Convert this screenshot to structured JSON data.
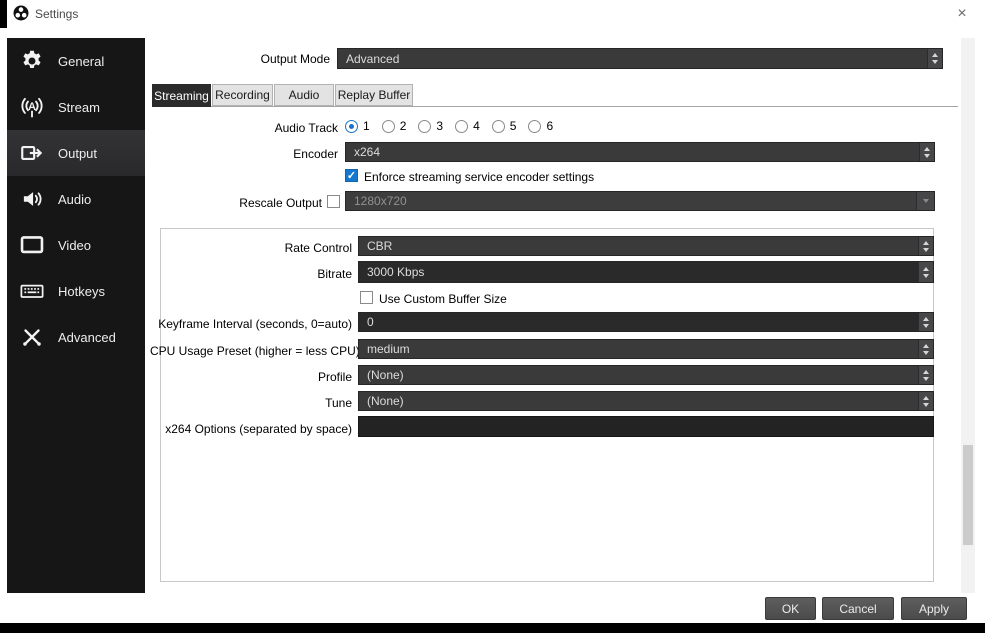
{
  "window": {
    "title": "Settings",
    "close": "×"
  },
  "colors": {
    "accent": "#1974c8",
    "sidebar_bg": "#161617",
    "control_bg": "#3a3a3b",
    "selected_tab_bg": "#2b2b2c"
  },
  "sidebar": {
    "items": [
      {
        "label": "General",
        "icon": "gear-icon",
        "selected": false
      },
      {
        "label": "Stream",
        "icon": "broadcast-icon",
        "selected": false
      },
      {
        "label": "Output",
        "icon": "output-icon",
        "selected": true
      },
      {
        "label": "Audio",
        "icon": "speaker-icon",
        "selected": false
      },
      {
        "label": "Video",
        "icon": "monitor-icon",
        "selected": false
      },
      {
        "label": "Hotkeys",
        "icon": "keyboard-icon",
        "selected": false
      },
      {
        "label": "Advanced",
        "icon": "tools-icon",
        "selected": false
      }
    ]
  },
  "output_mode": {
    "label": "Output Mode",
    "value": "Advanced"
  },
  "tabs": [
    {
      "label": "Streaming",
      "selected": true
    },
    {
      "label": "Recording",
      "selected": false
    },
    {
      "label": "Audio",
      "selected": false
    },
    {
      "label": "Replay Buffer",
      "selected": false
    }
  ],
  "streaming": {
    "audio_track": {
      "label": "Audio Track",
      "options": [
        "1",
        "2",
        "3",
        "4",
        "5",
        "6"
      ],
      "selected": "1"
    },
    "encoder": {
      "label": "Encoder",
      "value": "x264"
    },
    "enforce": {
      "label": "Enforce streaming service encoder settings",
      "checked": true
    },
    "rescale": {
      "label": "Rescale Output",
      "checked": false,
      "value": "1280x720",
      "disabled": true
    },
    "rate_control": {
      "label": "Rate Control",
      "value": "CBR"
    },
    "bitrate": {
      "label": "Bitrate",
      "value": "3000 Kbps"
    },
    "custom_buffer": {
      "label": "Use Custom Buffer Size",
      "checked": false
    },
    "keyframe": {
      "label": "Keyframe Interval (seconds, 0=auto)",
      "value": "0"
    },
    "cpu_preset": {
      "label": "CPU Usage Preset (higher = less CPU)",
      "value": "medium"
    },
    "profile": {
      "label": "Profile",
      "value": "(None)"
    },
    "tune": {
      "label": "Tune",
      "value": "(None)"
    },
    "x264_options": {
      "label": "x264 Options (separated by space)",
      "value": ""
    }
  },
  "footer": {
    "ok": "OK",
    "cancel": "Cancel",
    "apply": "Apply"
  }
}
